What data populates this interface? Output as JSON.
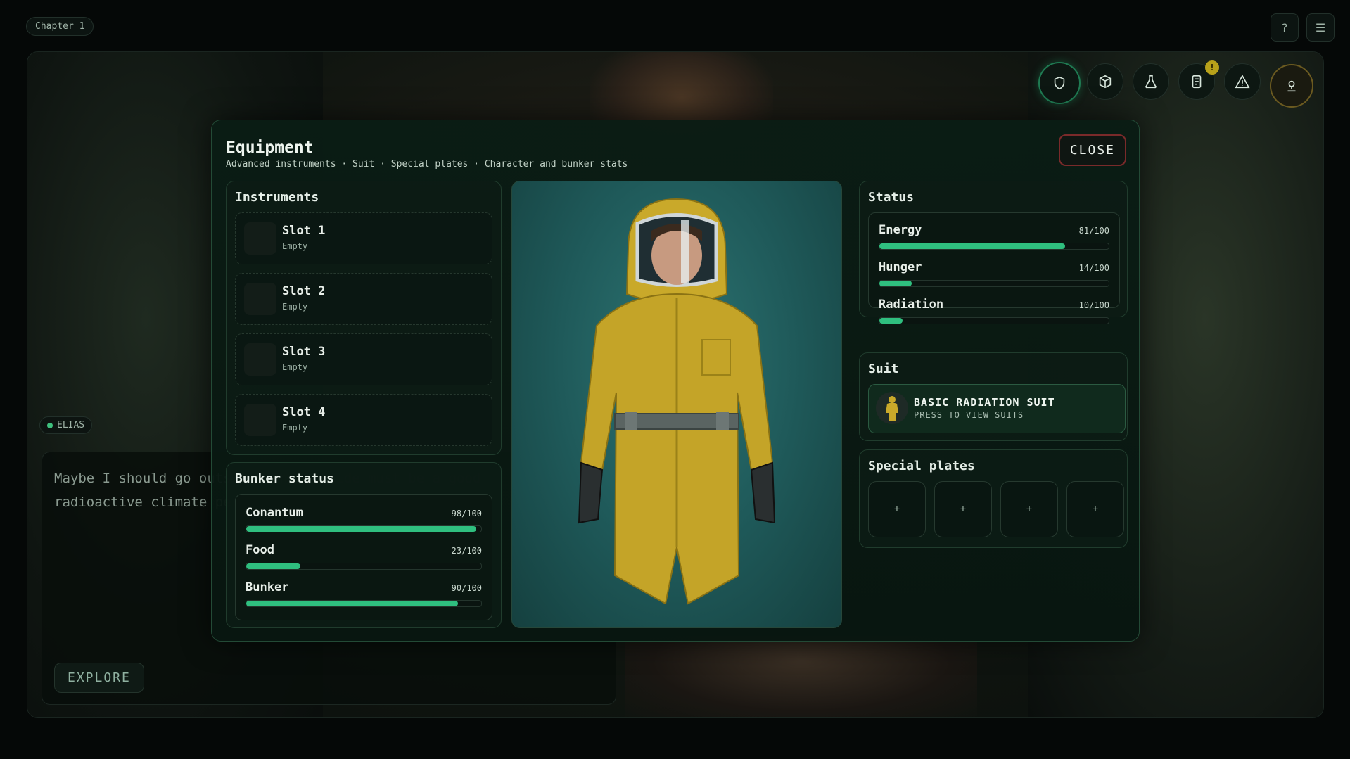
{
  "top_bar": {
    "chapter": "Chapter 1",
    "help_label": "?",
    "menu_label": "☰"
  },
  "hud": {
    "notification_badge": "!"
  },
  "dialogue": {
    "speaker": "ELIAS",
    "text": "Maybe I should go outside. The outside must be a good radioactive climate perfect for getting a nice tan.",
    "action": "EXPLORE"
  },
  "modal": {
    "title": "Equipment",
    "subtitle": "Advanced instruments · Suit · Special plates · Character and bunker stats",
    "close_label": "CLOSE",
    "instruments": {
      "title": "Instruments",
      "slots": [
        {
          "name": "Slot 1",
          "state": "Empty"
        },
        {
          "name": "Slot 2",
          "state": "Empty"
        },
        {
          "name": "Slot 3",
          "state": "Empty"
        },
        {
          "name": "Slot 4",
          "state": "Empty"
        }
      ]
    },
    "bunker": {
      "title": "Bunker status",
      "stats": [
        {
          "label": "Conantum",
          "value": "98/100",
          "fraction": 0.98
        },
        {
          "label": "Food",
          "value": "23/100",
          "fraction": 0.23
        },
        {
          "label": "Bunker",
          "value": "90/100",
          "fraction": 0.9
        }
      ]
    },
    "status": {
      "title": "Status",
      "stats": [
        {
          "label": "Energy",
          "value": "81/100",
          "fraction": 0.81
        },
        {
          "label": "Hunger",
          "value": "14/100",
          "fraction": 0.14
        },
        {
          "label": "Radiation",
          "value": "10/100",
          "fraction": 0.1
        }
      ]
    },
    "suit": {
      "title": "Suit",
      "name": "BASIC RADIATION SUIT",
      "hint": "PRESS TO VIEW SUITS"
    },
    "plates": {
      "title": "Special plates",
      "items": [
        "+",
        "+",
        "+",
        "+"
      ]
    }
  },
  "colors": {
    "accent": "#2fbf7f",
    "close_border": "#7a2a2a",
    "suit_yellow": "#c9a92a",
    "notification": "#b8a11a"
  },
  "icons": [
    "shield-icon",
    "box-icon",
    "flask-icon",
    "journal-icon",
    "warning-icon",
    "profile-icon"
  ]
}
